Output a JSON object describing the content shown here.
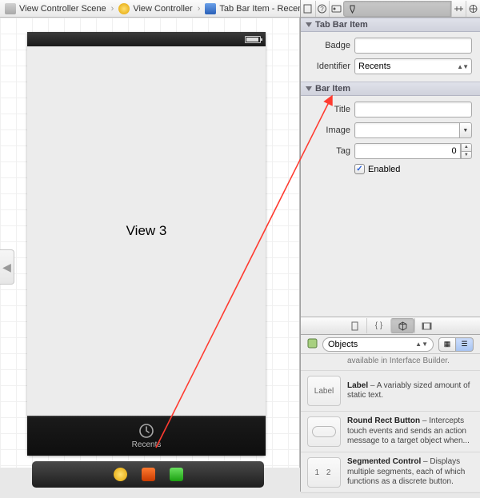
{
  "breadcrumb": {
    "items": [
      {
        "label": "View Controller Scene"
      },
      {
        "label": "View Controller"
      },
      {
        "label": "Tab Bar Item - Recents"
      }
    ]
  },
  "view_label": "View 3",
  "tab_item": {
    "label": "Recents"
  },
  "inspector": {
    "tab_bar_item": {
      "title": "Tab Bar Item",
      "badge_label": "Badge",
      "badge_value": "",
      "identifier_label": "Identifier",
      "identifier_value": "Recents"
    },
    "bar_item": {
      "title": "Bar Item",
      "title_label": "Title",
      "title_value": "",
      "image_label": "Image",
      "image_value": "",
      "tag_label": "Tag",
      "tag_value": "0",
      "enabled_label": "Enabled",
      "enabled": true
    }
  },
  "library": {
    "dropdown": "Objects",
    "partial_prev": "available in Interface Builder.",
    "items": [
      {
        "name": "Label",
        "desc": " – A variably sized amount of static text.",
        "thumb": "Label"
      },
      {
        "name": "Round Rect Button",
        "desc": " – Intercepts touch events and sends an action message to a target object when...",
        "thumb": ""
      },
      {
        "name": "Segmented Control",
        "desc": " – Displays multiple segments, each of which functions as a discrete button.",
        "thumb": "1 2"
      }
    ]
  }
}
